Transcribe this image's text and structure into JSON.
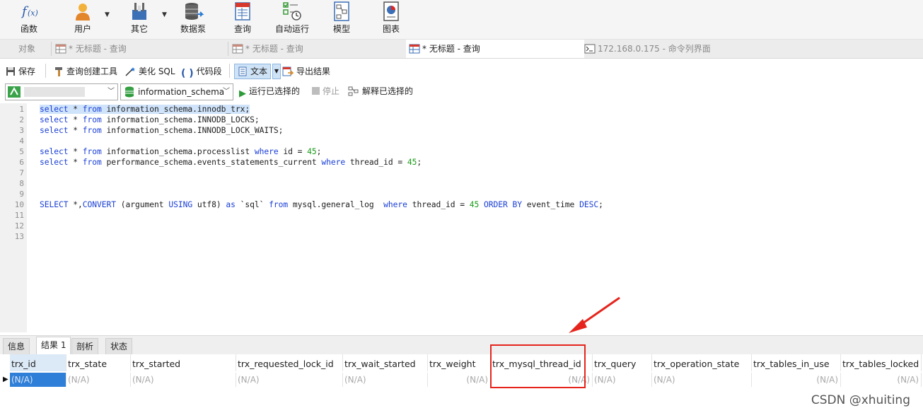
{
  "toolbar": {
    "items": [
      {
        "label": "函数",
        "icon": "function-icon"
      },
      {
        "label": "用户",
        "icon": "user-icon"
      },
      {
        "label": "其它",
        "icon": "tools-icon"
      },
      {
        "label": "数据泵",
        "icon": "database-pump-icon"
      },
      {
        "label": "查询",
        "icon": "query-icon"
      },
      {
        "label": "自动运行",
        "icon": "auto-run-icon"
      },
      {
        "label": "模型",
        "icon": "model-icon"
      },
      {
        "label": "图表",
        "icon": "chart-icon"
      }
    ]
  },
  "tabs": {
    "objects": "对象",
    "items": [
      {
        "label": "* 无标题 - 查询",
        "active": false
      },
      {
        "label": "* 无标题 - 查询",
        "active": false
      },
      {
        "label": "* 无标题 - 查询",
        "active": true
      },
      {
        "label": "172.168.0.175 - 命令列界面",
        "active": false
      }
    ]
  },
  "query_toolbar": {
    "save": "保存",
    "query_builder": "查询创建工具",
    "beautify": "美化 SQL",
    "snippet": "代码段",
    "text": "文本",
    "export": "导出结果"
  },
  "run_toolbar": {
    "database": "information_schema",
    "run_selected": "运行已选择的",
    "stop": "停止",
    "explain": "解释已选择的"
  },
  "editor": {
    "line_numbers": [
      "1",
      "2",
      "3",
      "4",
      "5",
      "6",
      "7",
      "8",
      "9",
      "10",
      "11",
      "12",
      "13"
    ],
    "lines": [
      "select * from information_schema.innodb_trx;",
      "select * from information_schema.INNODB_LOCKS;",
      "select * from information_schema.INNODB_LOCK_WAITS;",
      "",
      "select * from information_schema.processlist where id = 45;",
      "select * from performance_schema.events_statements_current where thread_id = 45;",
      "",
      "",
      "",
      "SELECT *,CONVERT (argument USING utf8) as `sql` from mysql.general_log  where thread_id = 45 ORDER BY event_time DESC;",
      "",
      "",
      ""
    ]
  },
  "result_tabs": [
    "信息",
    "结果 1",
    "剖析",
    "状态"
  ],
  "grid": {
    "columns": [
      "trx_id",
      "trx_state",
      "trx_started",
      "trx_requested_lock_id",
      "trx_wait_started",
      "trx_weight",
      "trx_mysql_thread_id",
      "trx_query",
      "trx_operation_state",
      "trx_tables_in_use",
      "trx_tables_locked"
    ],
    "row": [
      "(N/A)",
      "(N/A)",
      "(N/A)",
      "(N/A)",
      "(N/A)",
      "(N/A)",
      "(N/A)",
      "(N/A)",
      "(N/A)",
      "(N/A)",
      "(N/A)"
    ]
  },
  "watermark": "CSDN @xhuiting",
  "colors": {
    "accent": "#2f7fd8",
    "highlight": "#e5251d",
    "keyword": "#1a3fd6",
    "number": "#1a9b1a"
  }
}
